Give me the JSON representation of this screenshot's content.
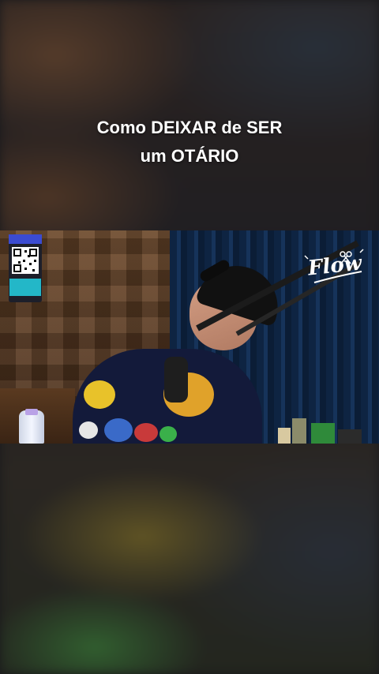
{
  "caption": {
    "line1": "Como DEIXAR de SER",
    "line2": "um OTÁRIO"
  },
  "video": {
    "channel_logo_text": "Flow",
    "qr_card": {
      "icon": "qr-code-icon",
      "accent": "#3b4bd1",
      "foot_accent": "#23b7c8"
    }
  },
  "colors": {
    "caption_text": "#ffffff",
    "background": "#1a1a1c"
  }
}
